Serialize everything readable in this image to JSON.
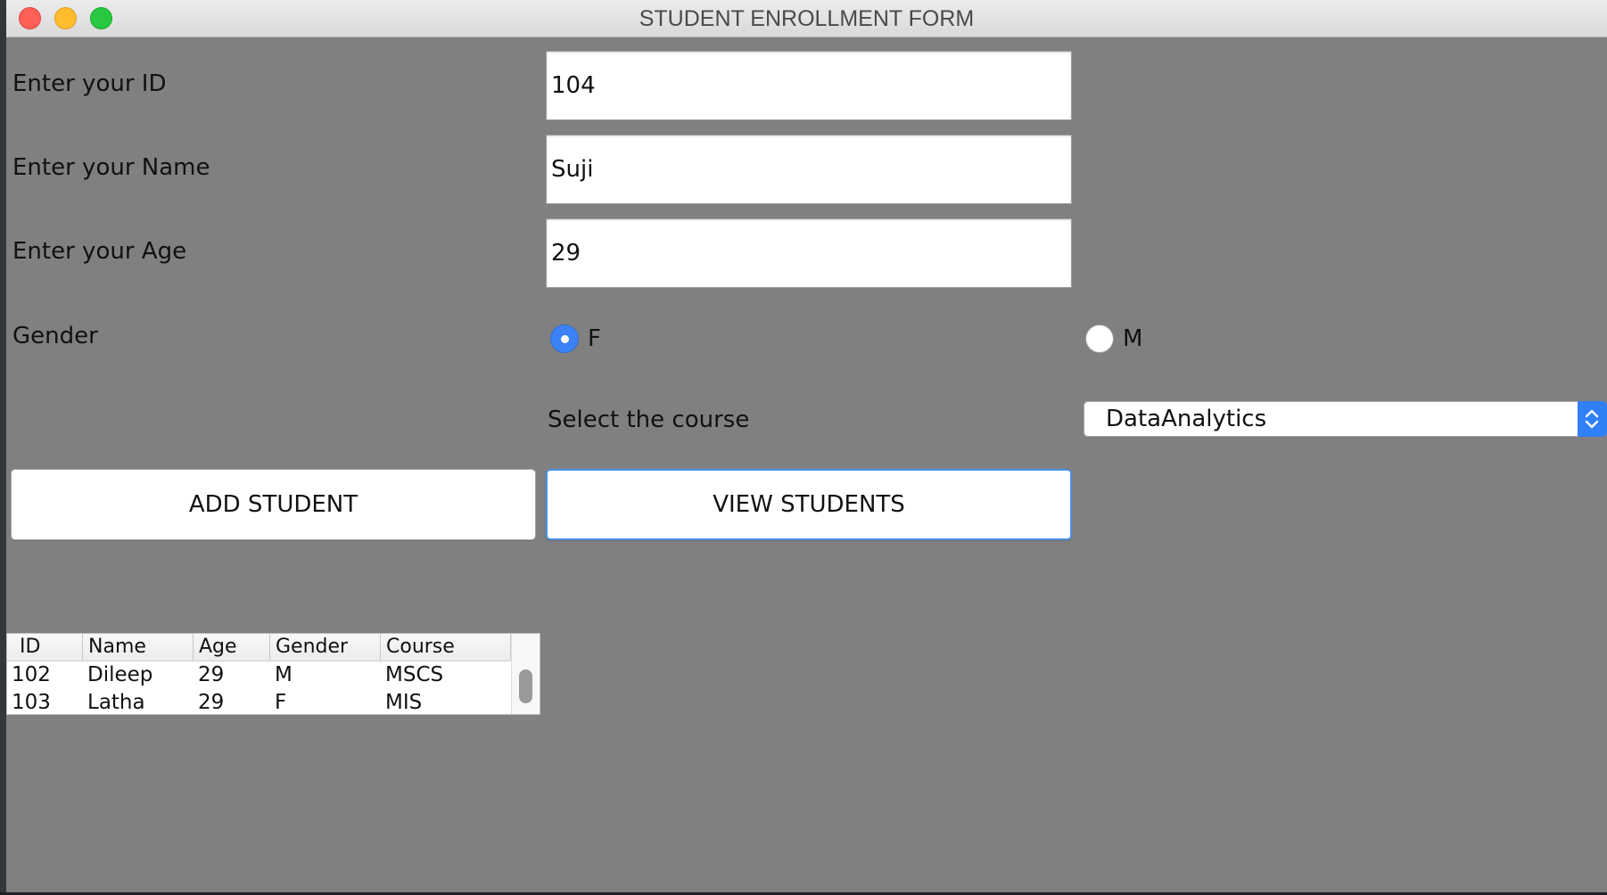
{
  "window": {
    "title": "STUDENT ENROLLMENT FORM"
  },
  "form": {
    "id_label": "Enter your ID",
    "id_value": "104",
    "name_label": "Enter your Name",
    "name_value": "Suji",
    "age_label": "Enter your Age",
    "age_value": "29",
    "gender_label": "Gender",
    "gender_options": [
      {
        "label": "F",
        "selected": true
      },
      {
        "label": "M",
        "selected": false
      }
    ],
    "course_label": "Select the course",
    "course_selected": "DataAnalytics"
  },
  "buttons": {
    "add_label": "ADD STUDENT",
    "view_label": "VIEW STUDENTS"
  },
  "table": {
    "columns": [
      "ID",
      "Name",
      "Age",
      "Gender",
      "Course"
    ],
    "rows": [
      [
        "102",
        "Dileep",
        "29",
        "M",
        "MSCS"
      ],
      [
        "103",
        "Latha",
        "29",
        "F",
        "MIS"
      ]
    ]
  },
  "colors": {
    "window_bg": "#808080",
    "accent": "#3b82f6"
  }
}
